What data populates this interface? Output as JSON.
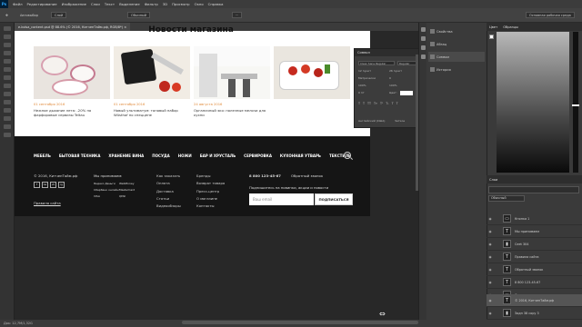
{
  "app": {
    "menu": [
      "Файл",
      "Редактирование",
      "Изображение",
      "Слои",
      "Текст",
      "Выделение",
      "Фильтр",
      "3D",
      "Просмотр",
      "Окно",
      "Справка"
    ],
    "logo": "Ps"
  },
  "options": {
    "auto_select_label": "Автовыбор",
    "auto_select_value": "Слой",
    "mode_label": "Обычный",
    "workspace": "Основная рабочая среда"
  },
  "document": {
    "tab_title": "e-kolsa_content.psd @ 88.6% (© 2016, КитченТайм.рф, RGB/8*) ×",
    "status": "Док: 12,7M/1,32G"
  },
  "page": {
    "news_title": "Новости магазина",
    "news": [
      {
        "date": "01 сентября 2016",
        "text": "Нежное дыхание лета: -20% на фарфоровые сервизы Teltau"
      },
      {
        "date": "01 сентября 2016",
        "text": "Новый ультиматум: топовый набор Wüsthof по спеццене"
      },
      {
        "date": "24 августа 2016",
        "text": "Органичный эко: полезные мелочи для кухни"
      },
      {
        "date": "",
        "text": ""
      }
    ],
    "nav": [
      "МЕБЕЛЬ",
      "БЫТОВАЯ ТЕХНИКА",
      "ХРАНЕНИЕ ВИНА",
      "ПОСУДА",
      "НОЖИ",
      "БАР И ХРУСТАЛЬ",
      "СЕРВИРОВКА",
      "КУХОННАЯ УТВАРЬ",
      "ТЕКСТИЛЬ"
    ],
    "copyright": "© 2016, КитченТайм.рф",
    "rules": "Правила сайта",
    "we_accept": "Мы принимаем:",
    "payments": [
      "Яндекс.Деньги",
      "Сбербанк онлайн",
      "VISA",
      "WebMoney",
      "MasterCard",
      "QIWI"
    ],
    "col1": [
      "Как заказать",
      "Оплата",
      "Доставка",
      "Статьи",
      "Видеообзоры"
    ],
    "col2": [
      "Бренды",
      "Возврат товара",
      "Пресс-центр",
      "О магазине",
      "Контакты"
    ],
    "phone": "8 800 123-45-67",
    "callback": "Обратный звонок",
    "subscribe_text": "Подпишитесь на новинки, акции и новости",
    "email_placeholder": "Ваш email",
    "subscribe_button": "ПОДПИСАТЬСЯ",
    "social": [
      "f",
      "tw",
      "vk",
      "ig"
    ]
  },
  "char_panel": {
    "title": "Символ",
    "font": "Clear Sans Regular",
    "style": "Regular",
    "size": "12 пункт",
    "leading": "26 пункт",
    "tracking_label": "Метрически",
    "tracking_value": "0",
    "vscale": "100%",
    "hscale": "100%",
    "baseline": "0 пт",
    "color_label": "Цвет:",
    "language": "Английский (США)",
    "aa": "Четкое",
    "style_buttons": [
      "T",
      "T",
      "TT",
      "Tт",
      "T¹",
      "T₁",
      "T",
      "T"
    ]
  },
  "mid_panel": [
    {
      "label": "Свойства"
    },
    {
      "label": "Абзац"
    },
    {
      "label": "Символ"
    },
    {
      "label": "История"
    }
  ],
  "right": {
    "color_tabs": [
      "Цвет",
      "Образцы"
    ],
    "layers_title": "Слои",
    "layers": [
      {
        "label": "Кнопка 1",
        "kind": "folder"
      },
      {
        "label": "Мы принимаем",
        "kind": "T"
      },
      {
        "label": "Сeet 304",
        "kind": "img"
      },
      {
        "label": "Правила сайта",
        "kind": "T"
      },
      {
        "label": "Обратный звонок",
        "kind": "T"
      },
      {
        "label": "8 800 123-45-67",
        "kind": "T"
      },
      {
        "label": "Сведете сорт",
        "kind": "folder"
      },
      {
        "label": "© 2016, КитченТайм.рф",
        "kind": "T",
        "selected": true
      },
      {
        "label": "Задн 38 copy 3",
        "kind": "img"
      }
    ]
  }
}
